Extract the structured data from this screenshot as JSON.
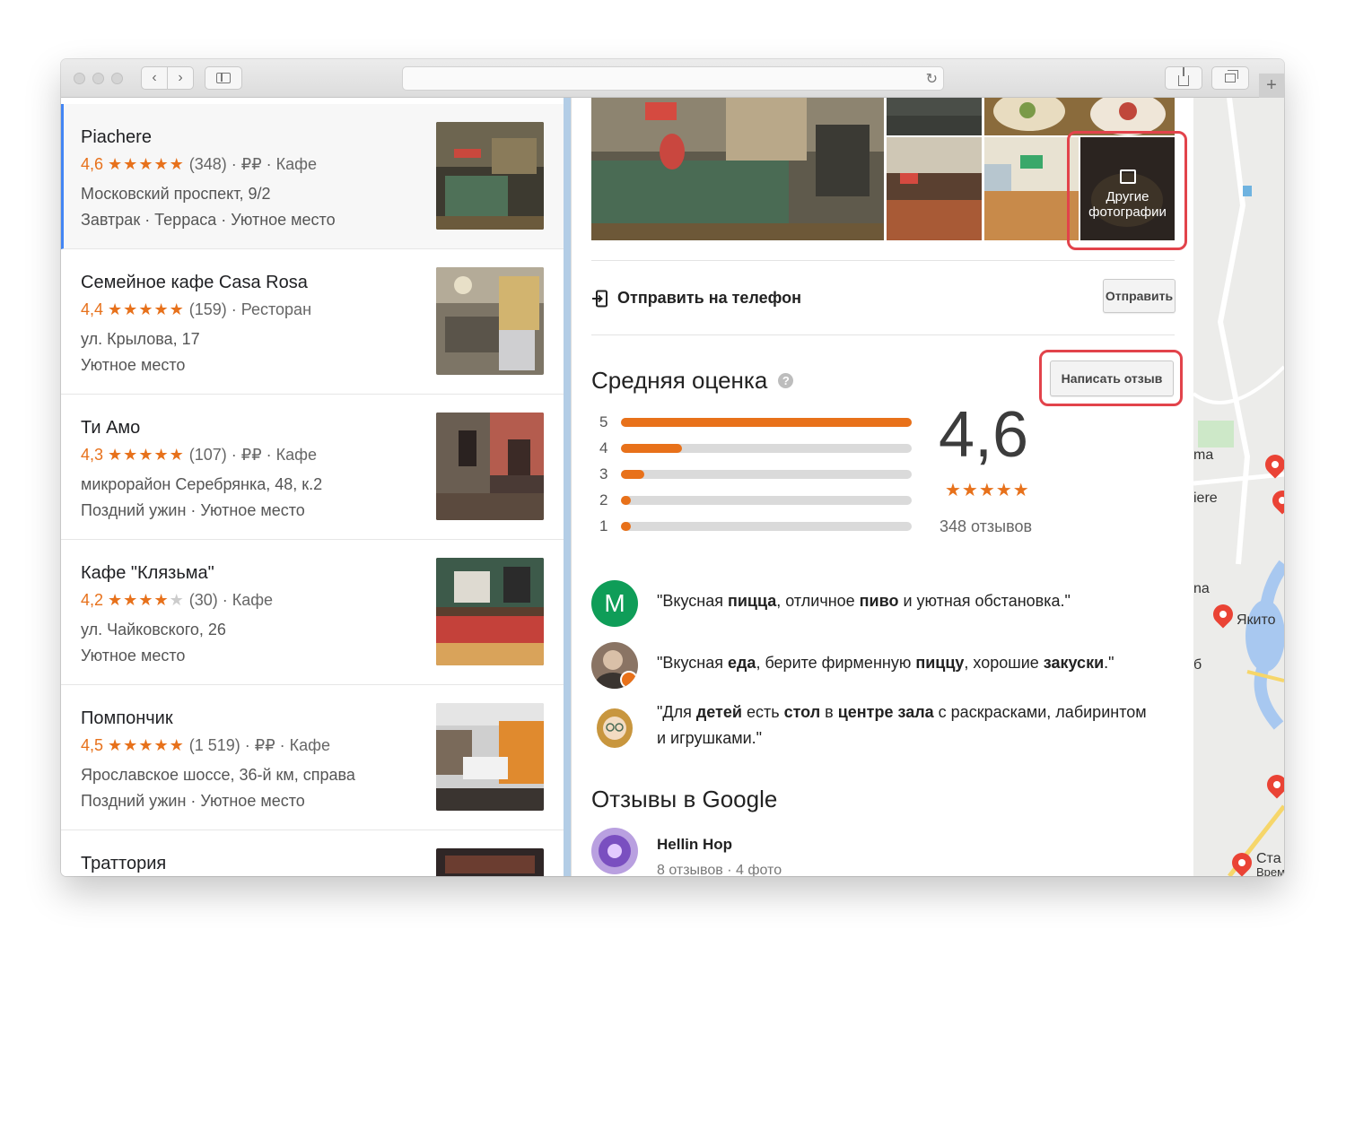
{
  "browser": {
    "nav_back": "‹",
    "nav_forward": "›",
    "reload": "↻",
    "new_tab": "+"
  },
  "results": [
    {
      "name": "Piachere",
      "rating": "4,6",
      "stars": "★★★★",
      "half_star": "★",
      "empty_stars": "",
      "reviews_price_type": "(348) · ₽₽ · Кафе",
      "address": "Московский проспект, 9/2",
      "tags": "Завтрак · Терраса · Уютное место"
    },
    {
      "name": "Семейное кафе Casa Rosa",
      "rating": "4,4",
      "stars": "★★★★",
      "half_star": "★",
      "empty_stars": "",
      "reviews_price_type": "(159) · Ресторан",
      "address": "ул. Крылова, 17",
      "tags": "Уютное место"
    },
    {
      "name": "Ти Амо",
      "rating": "4,3",
      "stars": "★★★★",
      "half_star": "★",
      "empty_stars": "",
      "reviews_price_type": "(107) · ₽₽ · Кафе",
      "address": "микрорайон Серебрянка, 48, к.2",
      "tags": "Поздний ужин · Уютное место"
    },
    {
      "name": "Кафе \"Клязьма\"",
      "rating": "4,2",
      "stars": "★★★★",
      "half_star": "",
      "empty_stars": "★",
      "reviews_price_type": "(30) · Кафе",
      "address": "ул. Чайковского, 26",
      "tags": "Уютное место"
    },
    {
      "name": "Помпончик",
      "rating": "4,5",
      "stars": "★★★★",
      "half_star": "★",
      "empty_stars": "",
      "reviews_price_type": "(1 519) · ₽₽ · Кафе",
      "address": "Ярославское шоссе, 36-й км, справа",
      "tags": "Поздний ужин · Уютное место"
    },
    {
      "name": "Траттория",
      "rating": "",
      "stars": "",
      "half_star": "",
      "empty_stars": "",
      "reviews_price_type": "",
      "address": "",
      "tags": ""
    }
  ],
  "details": {
    "more_photos_label_1": "Другие",
    "more_photos_label_2": "фотографии",
    "send_to_phone_label": "Отправить на телефон",
    "send_button": "Отправить",
    "rating_section_title": "Средняя оценка",
    "help_glyph": "?",
    "write_review_button": "Написать отзыв",
    "distribution": [
      {
        "stars": "5",
        "fraction": 1.0
      },
      {
        "stars": "4",
        "fraction": 0.21
      },
      {
        "stars": "3",
        "fraction": 0.08
      },
      {
        "stars": "2",
        "fraction": 0.035
      },
      {
        "stars": "1",
        "fraction": 0.035
      }
    ],
    "average": "4,6",
    "average_stars": "★★★★★",
    "review_count": "348 отзывов",
    "snippets": [
      {
        "avatar_letter": "M"
      }
    ],
    "google_reviews_title": "Отзывы в Google",
    "reviewer_name": "Hellin Hop",
    "reviewer_meta": "8 отзывов · 4 фото"
  },
  "map": {
    "labels": [
      "ma",
      "iere",
      "na",
      "Якито",
      "б",
      "Ста",
      "Врем"
    ]
  },
  "colors": {
    "accent_orange": "#e8711a",
    "selection_blue": "#4285f4",
    "highlight_red": "#e2434b",
    "avatar_green": "#0f9d58"
  }
}
